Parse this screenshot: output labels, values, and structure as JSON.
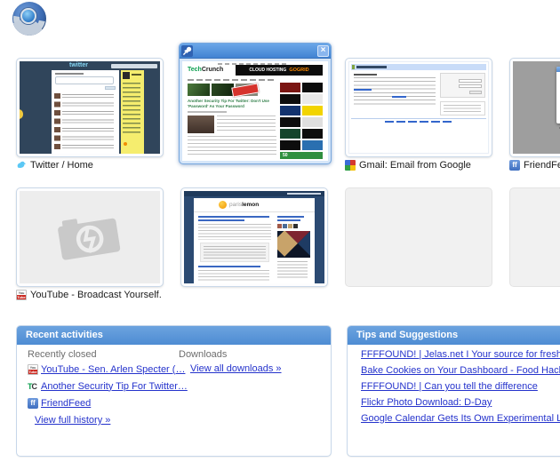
{
  "logo": {
    "name": "Chromium"
  },
  "favicons": {
    "youtube_top": "You",
    "youtube_bottom": "Tube",
    "techcrunch_t": "T",
    "techcrunch_c": "C",
    "friendfeed_glyph": "ff",
    "close_glyph": "×"
  },
  "thumbs": {
    "twitter": {
      "label": "Twitter / Home",
      "logo_text": "twitter"
    },
    "techcrunch": {
      "label": "",
      "logo_tech": "Tech",
      "logo_crunch": "Crunch",
      "banner": "CLOUD HOSTING",
      "banner_brand": "GOGRID",
      "headline": "Another Security Tip For Twitter: Don't Use 'Password' As Your Password",
      "sidebar_badge": "50"
    },
    "gmail": {
      "label": "Gmail: Email from Google"
    },
    "friendfeed": {
      "label": "FriendFeed"
    },
    "youtube": {
      "label": "YouTube - Broadcast Yourself."
    },
    "parislemon": {
      "logo_gray": "paris",
      "logo_bold": "lemon"
    }
  },
  "recent": {
    "title": "Recent activities",
    "recently_closed_label": "Recently closed",
    "items": [
      {
        "label": "YouTube - Sen. Arlen Specter (…"
      },
      {
        "label": "Another Security Tip For Twitter…"
      },
      {
        "label": "FriendFeed"
      }
    ],
    "view_full_history": "View full history »",
    "downloads_label": "Downloads",
    "view_all_downloads": "View all downloads »"
  },
  "tips": {
    "title": "Tips and Suggestions",
    "links": [
      {
        "label": "FFFFOUND! | Jelas.net I Your source for fresh art"
      },
      {
        "label": "Bake Cookies on Your Dashboard - Food Hacks -"
      },
      {
        "label": "FFFFOUND! | Can you tell the difference"
      },
      {
        "label": "Flickr Photo Download: D-Day"
      },
      {
        "label": "Google Calendar Gets Its Own Experimental Labs"
      }
    ]
  },
  "colors": {
    "panel_header_blue": "#5b97db",
    "selected_titlebar_blue": "#4f8fd9",
    "link_blue": "#2533cc",
    "label_gray": "#6e6e6e",
    "twitter_navy": "#30455b",
    "twitter_yellow": "#f5ed6e",
    "parislemon_navy": "#2b4a72"
  }
}
